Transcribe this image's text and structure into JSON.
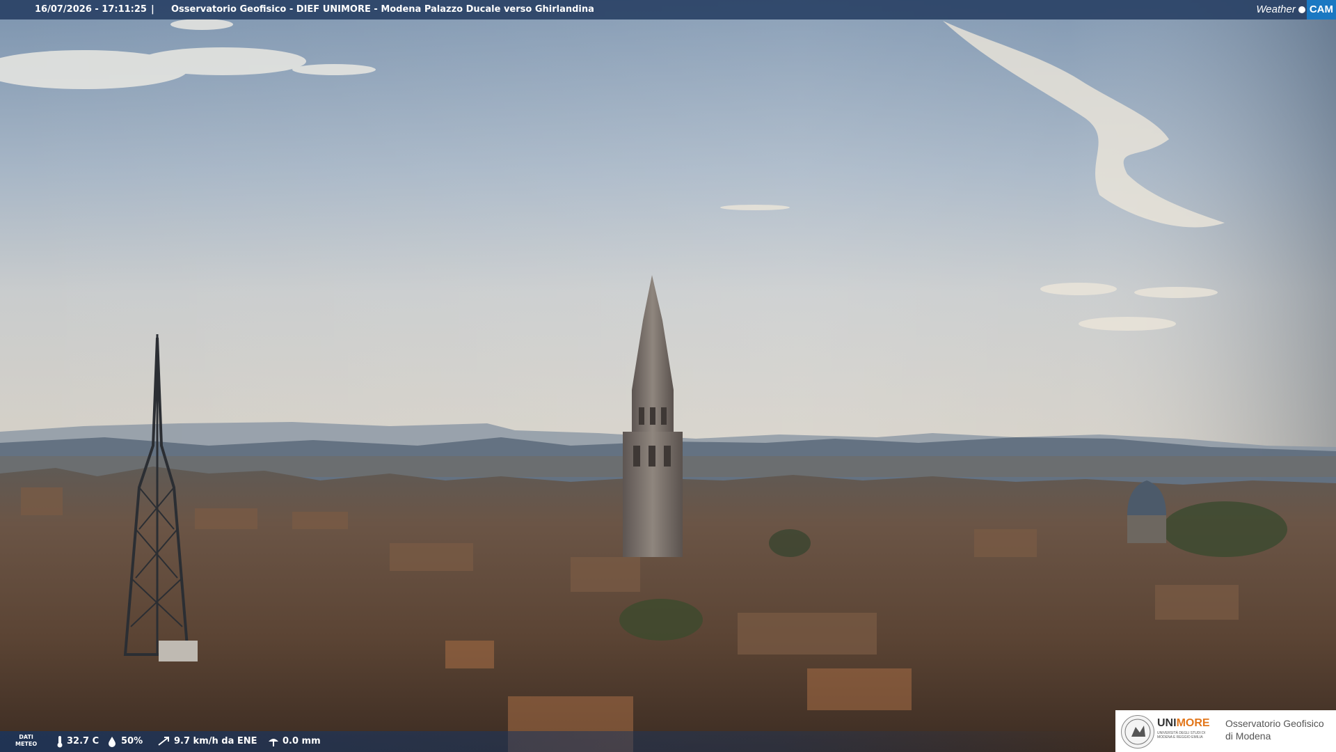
{
  "header": {
    "timestamp": "16/07/2026 - 17:11:25",
    "separator": "|",
    "title": "Osservatorio Geofisico - DIEF UNIMORE - Modena Palazzo Ducale verso Ghirlandina",
    "brand_left": "Weather",
    "brand_right": "CAM"
  },
  "meteo": {
    "label_line1": "DATI",
    "label_line2": "METEO",
    "temperature": "32.7 C",
    "humidity": "50%",
    "wind": "9.7 km/h da ENE",
    "rain": "0.0 mm"
  },
  "logo": {
    "uni": "UNI",
    "more": "MORE",
    "sub": "UNIVERSITÀ DEGLI STUDI DI MODENA E REGGIO EMILIA",
    "obs_line1": "Osservatorio Geofisico",
    "obs_line2": "di Modena"
  },
  "colors": {
    "bar": "#263e62",
    "accent": "#1a78c2",
    "unimore_orange": "#e2761a"
  }
}
